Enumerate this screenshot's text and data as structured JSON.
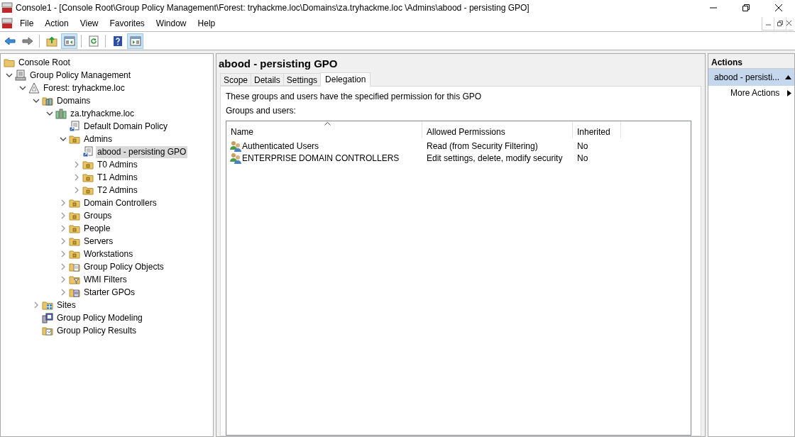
{
  "window": {
    "title": "Console1 - [Console Root\\Group Policy Management\\Forest: tryhackme.loc\\Domains\\za.tryhackme.loc \\Admins\\abood - persisting GPO]"
  },
  "menu": [
    "File",
    "Action",
    "View",
    "Favorites",
    "Window",
    "Help"
  ],
  "toolbar": [
    {
      "kind": "back",
      "selected": false
    },
    {
      "kind": "forward",
      "selected": false
    },
    {
      "kind": "sep"
    },
    {
      "kind": "up",
      "selected": false
    },
    {
      "kind": "tree",
      "selected": true
    },
    {
      "kind": "sep"
    },
    {
      "kind": "refresh",
      "selected": false
    },
    {
      "kind": "sep"
    },
    {
      "kind": "help",
      "selected": false
    },
    {
      "kind": "actionpane",
      "selected": true
    }
  ],
  "tree": {
    "label": "Console Root",
    "kind": "folder",
    "selected": false,
    "children": [
      {
        "label": "Group Policy Management",
        "kind": "gpm",
        "selected": false,
        "expanded": true,
        "children": [
          {
            "label": "Forest: tryhackme.loc",
            "kind": "forest",
            "selected": false,
            "expanded": true,
            "children": [
              {
                "label": "Domains",
                "kind": "domains",
                "selected": false,
                "expanded": true,
                "children": [
                  {
                    "label": "za.tryhackme.loc",
                    "kind": "domain",
                    "selected": false,
                    "expanded": true,
                    "children": [
                      {
                        "label": "Default Domain Policy",
                        "kind": "gpolink",
                        "selected": false
                      },
                      {
                        "label": "Admins",
                        "kind": "ou",
                        "selected": false,
                        "expanded": true,
                        "children": [
                          {
                            "label": "abood - persisting GPO",
                            "kind": "gpolink",
                            "selected": true
                          },
                          {
                            "label": "T0 Admins",
                            "kind": "ou",
                            "selected": false,
                            "expanded": false
                          },
                          {
                            "label": "T1 Admins",
                            "kind": "ou",
                            "selected": false,
                            "expanded": false
                          },
                          {
                            "label": "T2 Admins",
                            "kind": "ou",
                            "selected": false,
                            "expanded": false
                          }
                        ]
                      },
                      {
                        "label": "Domain Controllers",
                        "kind": "ou",
                        "selected": false,
                        "expanded": false
                      },
                      {
                        "label": "Groups",
                        "kind": "ou",
                        "selected": false,
                        "expanded": false
                      },
                      {
                        "label": "People",
                        "kind": "ou",
                        "selected": false,
                        "expanded": false
                      },
                      {
                        "label": "Servers",
                        "kind": "ou",
                        "selected": false,
                        "expanded": false
                      },
                      {
                        "label": "Workstations",
                        "kind": "ou",
                        "selected": false,
                        "expanded": false
                      },
                      {
                        "label": "Group Policy Objects",
                        "kind": "gpofolder",
                        "selected": false,
                        "expanded": false
                      },
                      {
                        "label": "WMI Filters",
                        "kind": "wmi",
                        "selected": false,
                        "expanded": false
                      },
                      {
                        "label": "Starter GPOs",
                        "kind": "starter",
                        "selected": false,
                        "expanded": false
                      }
                    ]
                  }
                ]
              },
              {
                "label": "Sites",
                "kind": "sites",
                "selected": false,
                "expanded": false
              },
              {
                "label": "Group Policy Modeling",
                "kind": "modeling",
                "selected": false
              },
              {
                "label": "Group Policy Results",
                "kind": "results",
                "selected": false
              }
            ]
          }
        ]
      }
    ]
  },
  "detail": {
    "title": "abood - persisting GPO",
    "tabs": [
      {
        "label": "Scope",
        "selected": false
      },
      {
        "label": "Details",
        "selected": false
      },
      {
        "label": "Settings",
        "selected": false
      },
      {
        "label": "Delegation",
        "selected": true
      }
    ],
    "description": "These groups and users have the specified permission for this GPO",
    "list_label": "Groups and users:",
    "table": {
      "columns": [
        "Name",
        "Allowed Permissions",
        "Inherited"
      ],
      "rows": [
        [
          "Authenticated Users",
          "Read (from Security Filtering)",
          "No"
        ],
        [
          "ENTERPRISE DOMAIN CONTROLLERS",
          "Edit settings, delete, modify security",
          "No"
        ]
      ]
    }
  },
  "actions": {
    "title": "Actions",
    "items": [
      {
        "label": "abood - persisti...",
        "kind": "header",
        "selected": true
      },
      {
        "label": "More Actions",
        "kind": "submenu",
        "selected": false
      }
    ]
  }
}
